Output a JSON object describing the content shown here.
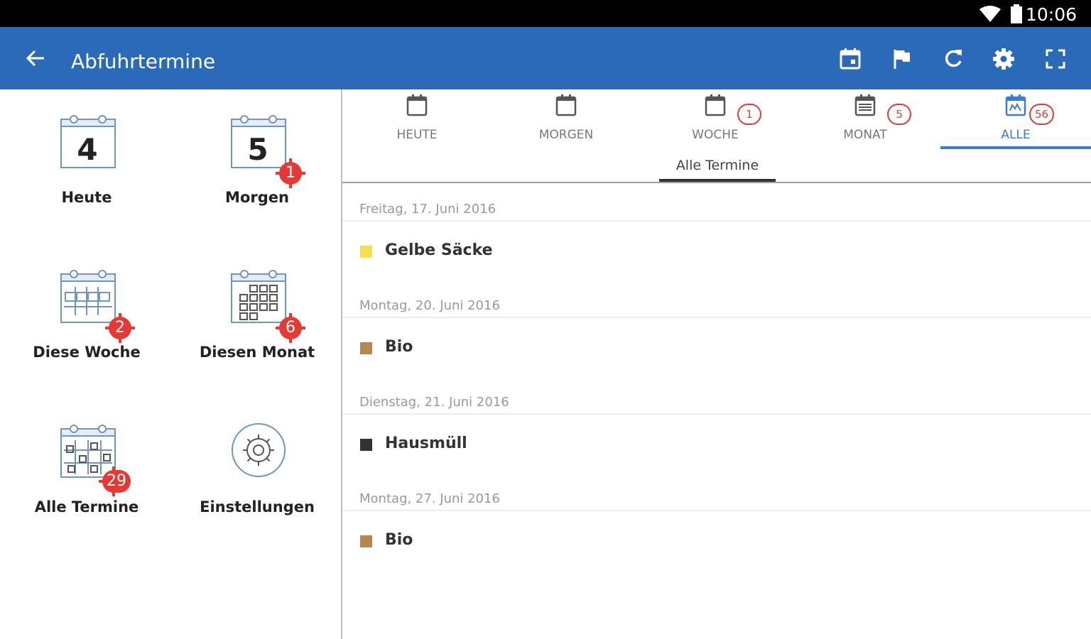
{
  "status": {
    "time": "10:06"
  },
  "appbar": {
    "title": "Abfuhrtermine"
  },
  "tiles": [
    {
      "label": "Heute",
      "day": "4",
      "badge": ""
    },
    {
      "label": "Morgen",
      "day": "5",
      "badge": "1"
    },
    {
      "label": "Diese Woche",
      "badge": "2"
    },
    {
      "label": "Diesen Monat",
      "badge": "6"
    },
    {
      "label": "Alle Termine",
      "badge": "29"
    },
    {
      "label": "Einstellungen",
      "badge": ""
    }
  ],
  "tabs": [
    {
      "label": "HEUTE",
      "count": ""
    },
    {
      "label": "MORGEN",
      "count": ""
    },
    {
      "label": "WOCHE",
      "count": "1"
    },
    {
      "label": "MONAT",
      "count": "5"
    },
    {
      "label": "ALLE",
      "count": "56"
    }
  ],
  "subtab": "Alle Termine",
  "entries": [
    {
      "date": "Freitag, 17. Juni 2016",
      "name": "Gelbe Säcke",
      "color": "#f9e04b"
    },
    {
      "date": "Montag, 20. Juni 2016",
      "name": "Bio",
      "color": "#b8874b"
    },
    {
      "date": "Dienstag, 21. Juni 2016",
      "name": "Hausmüll",
      "color": "#333333"
    },
    {
      "date": "Montag, 27. Juni 2016",
      "name": "Bio",
      "color": "#b8874b"
    }
  ],
  "colors": {
    "appbar": "#2a6ab8",
    "accent": "#3b7bd0",
    "badge": "#e53935"
  }
}
